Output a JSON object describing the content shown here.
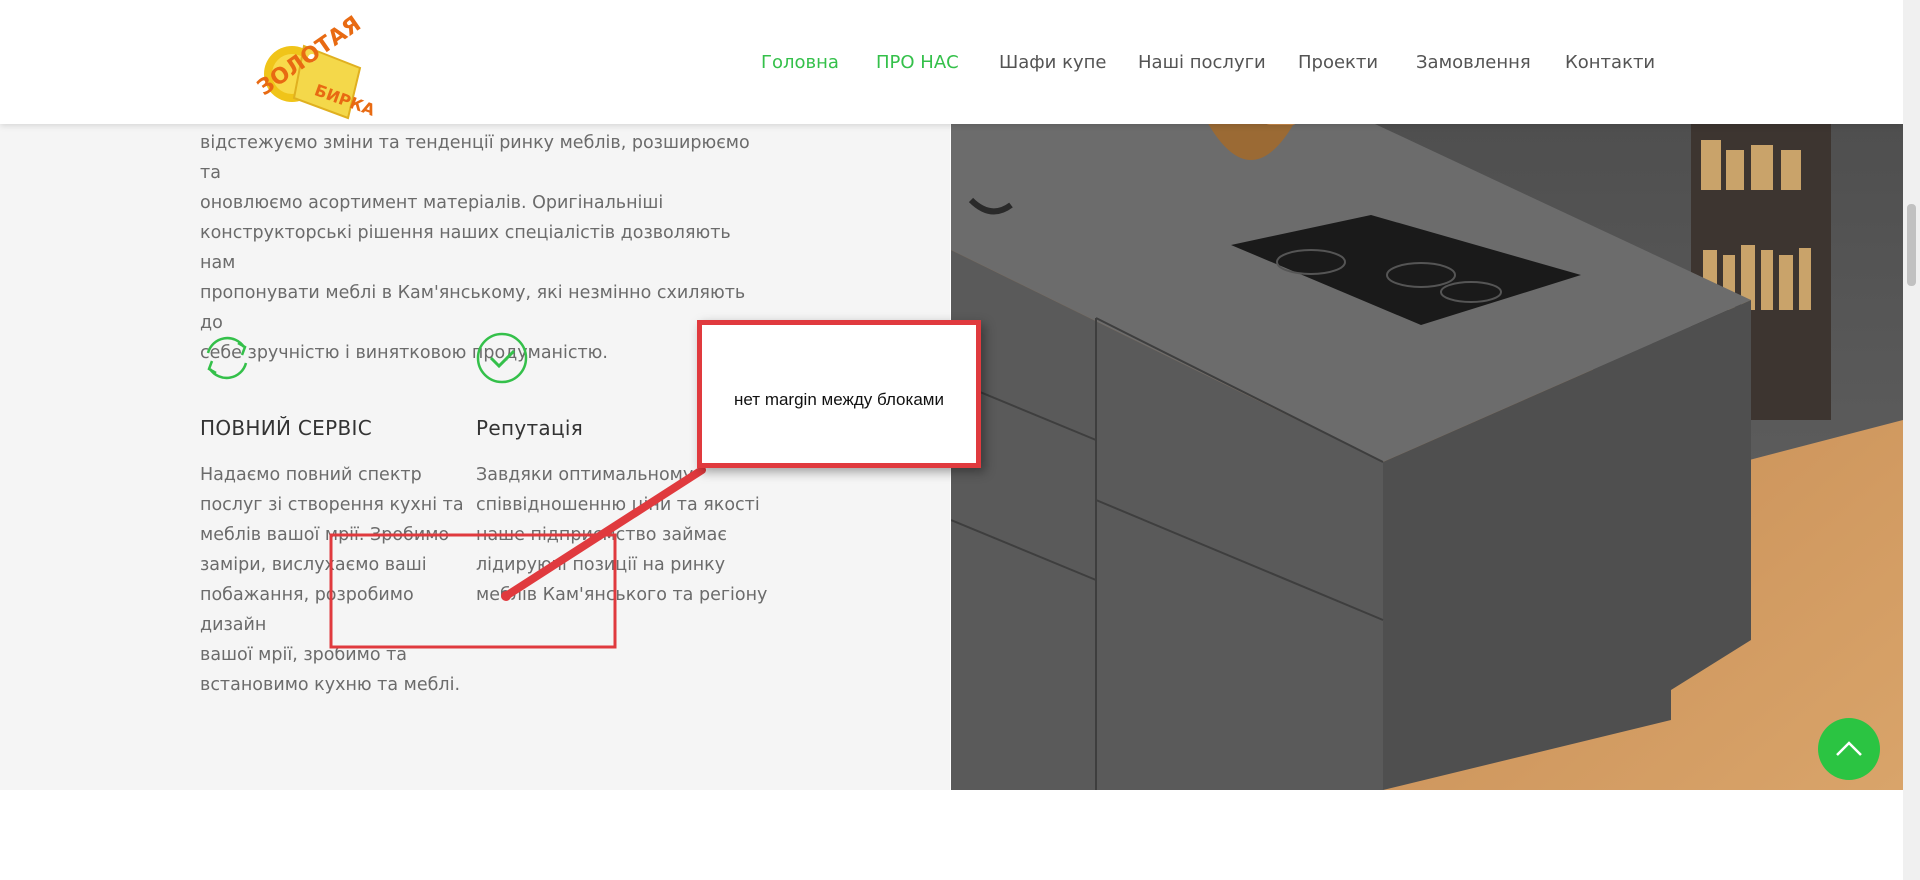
{
  "header": {
    "logo_alt": "Золотая бирка",
    "nav": [
      {
        "label": "Головна",
        "active": true
      },
      {
        "label": "ПРО НАС",
        "active": true
      },
      {
        "label": "Шафи купе",
        "active": false
      },
      {
        "label": "Наші послуги",
        "active": false
      },
      {
        "label": "Проекти",
        "active": false
      },
      {
        "label": "Замовлення",
        "active": false
      },
      {
        "label": "Контакти",
        "active": false
      }
    ]
  },
  "intro": {
    "lines": [
      "відстежуємо зміни та тенденції ринку меблів, розширюємо та",
      "оновлюємо асортимент матеріалів. Оригінальніші",
      "конструкторські рішення наших спеціалістів дозволяють нам",
      "пропонувати меблі в Кам'янському, які незмінно схиляють до",
      "себе зручністю і винятковою продуманістю."
    ]
  },
  "features": [
    {
      "icon": "refresh-icon",
      "title": "ПОВНИЙ СЕРВІС",
      "lines": [
        "Надаємо повний спектр",
        "послуг зі створення кухні та",
        "меблів вашої мрії. Зробимо",
        "заміри, вислухаємо ваші",
        "побажання, розробимо дизайн",
        "вашої мрії, зробимо та",
        "встановимо кухню та меблі."
      ]
    },
    {
      "icon": "check-circle-icon",
      "title": "Репутація",
      "lines": [
        "Завдяки оптимальному",
        "співвідношенню ціни та якості",
        "наше підприємство займає",
        "лідируючі позиції на ринку",
        "меблів Кам'янського та регіону"
      ]
    }
  ],
  "annotation": {
    "text": "нет margin между  блоками"
  },
  "colors": {
    "accent": "#34c04a",
    "annotation": "#e03a3e",
    "section_bg": "#f5f5f5"
  }
}
